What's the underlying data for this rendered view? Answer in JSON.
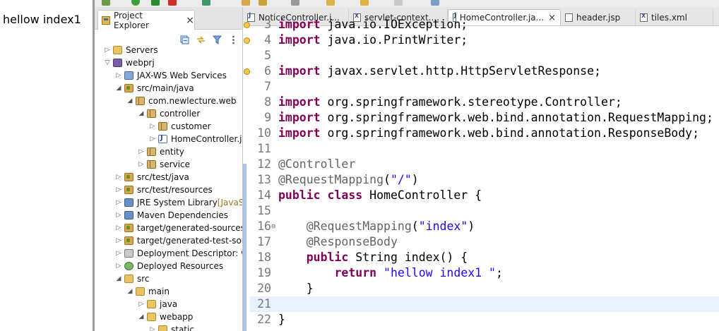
{
  "browser": {
    "output_text": "hellow index1"
  },
  "explorer": {
    "tab_label": "Project Explorer",
    "close_glyph": "×",
    "tree": [
      {
        "label": "Servers",
        "extra": "",
        "indent": 1,
        "twisty": "▷",
        "icon": "folder"
      },
      {
        "label": "webprj",
        "extra": "",
        "indent": 1,
        "twisty": "▽",
        "icon": "project"
      },
      {
        "label": "JAX-WS Web Services",
        "extra": "",
        "indent": 2,
        "twisty": "▷",
        "icon": "ws"
      },
      {
        "label": "src/main/java",
        "extra": "",
        "indent": 2,
        "twisty": "◢",
        "icon": "srcfolder"
      },
      {
        "label": "com.newlecture.web",
        "extra": "",
        "indent": 3,
        "twisty": "◢",
        "icon": "package"
      },
      {
        "label": "controller",
        "extra": "",
        "indent": 4,
        "twisty": "◢",
        "icon": "package"
      },
      {
        "label": "customer",
        "extra": "",
        "indent": 5,
        "twisty": "▷",
        "icon": "package"
      },
      {
        "label": "HomeController.ja",
        "extra": "",
        "indent": 5,
        "twisty": "▷",
        "icon": "java"
      },
      {
        "label": "entity",
        "extra": "",
        "indent": 4,
        "twisty": "▷",
        "icon": "package"
      },
      {
        "label": "service",
        "extra": "",
        "indent": 4,
        "twisty": "▷",
        "icon": "package"
      },
      {
        "label": "src/test/java",
        "extra": "",
        "indent": 2,
        "twisty": "▷",
        "icon": "srcfolder"
      },
      {
        "label": "src/test/resources",
        "extra": "",
        "indent": 2,
        "twisty": "▷",
        "icon": "srcfolder"
      },
      {
        "label": "JRE System Library",
        "extra": " [JavaSE-",
        "indent": 2,
        "twisty": "▷",
        "icon": "lib"
      },
      {
        "label": "Maven Dependencies",
        "extra": "",
        "indent": 2,
        "twisty": "▷",
        "icon": "lib"
      },
      {
        "label": "target/generated-sources/a",
        "extra": "",
        "indent": 2,
        "twisty": "▷",
        "icon": "srcfolder"
      },
      {
        "label": "target/generated-test-sourc",
        "extra": "",
        "indent": 2,
        "twisty": "▷",
        "icon": "srcfolder"
      },
      {
        "label": "Deployment Descriptor: we",
        "extra": "",
        "indent": 2,
        "twisty": "▷",
        "icon": "dd"
      },
      {
        "label": "Deployed Resources",
        "extra": "",
        "indent": 2,
        "twisty": "▷",
        "icon": "globe"
      },
      {
        "label": "src",
        "extra": "",
        "indent": 2,
        "twisty": "◢",
        "icon": "folder"
      },
      {
        "label": "main",
        "extra": "",
        "indent": 3,
        "twisty": "◢",
        "icon": "folder"
      },
      {
        "label": "java",
        "extra": "",
        "indent": 4,
        "twisty": "▷",
        "icon": "folder"
      },
      {
        "label": "webapp",
        "extra": "",
        "indent": 4,
        "twisty": "◢",
        "icon": "folder"
      },
      {
        "label": "static",
        "extra": "",
        "indent": 5,
        "twisty": "▷",
        "icon": "folder"
      }
    ]
  },
  "editor": {
    "tabs": [
      {
        "label": "NoticeController.j...",
        "kind": "j",
        "active": false
      },
      {
        "label": "servlet-context....",
        "kind": "x",
        "active": false
      },
      {
        "label": "HomeController.ja...",
        "kind": "j",
        "active": true
      },
      {
        "label": "header.jsp",
        "kind": "p",
        "active": false
      },
      {
        "label": "tiles.xml",
        "kind": "x",
        "active": false
      }
    ],
    "lines": [
      {
        "n": "3",
        "warn": true,
        "fold": "",
        "segs": [
          [
            "kw",
            "import"
          ],
          [
            "",
            " java.io.IOException;"
          ]
        ]
      },
      {
        "n": "4",
        "warn": true,
        "fold": "",
        "segs": [
          [
            "kw",
            "import"
          ],
          [
            "",
            " java.io.PrintWriter;"
          ]
        ]
      },
      {
        "n": "5",
        "warn": false,
        "fold": "",
        "segs": []
      },
      {
        "n": "6",
        "warn": true,
        "fold": "",
        "segs": [
          [
            "kw",
            "import"
          ],
          [
            "",
            " javax.servlet.http.HttpServletResponse;"
          ]
        ]
      },
      {
        "n": "7",
        "warn": false,
        "fold": "",
        "segs": []
      },
      {
        "n": "8",
        "warn": false,
        "fold": "",
        "segs": [
          [
            "kw",
            "import"
          ],
          [
            "",
            " org.springframework.stereotype.Controller;"
          ]
        ]
      },
      {
        "n": "9",
        "warn": false,
        "fold": "",
        "segs": [
          [
            "kw",
            "import"
          ],
          [
            "",
            " org.springframework.web.bind.annotation.RequestMapping;"
          ]
        ]
      },
      {
        "n": "10",
        "warn": false,
        "fold": "",
        "segs": [
          [
            "kw",
            "import"
          ],
          [
            "",
            " org.springframework.web.bind.annotation.ResponseBody;"
          ]
        ]
      },
      {
        "n": "11",
        "warn": false,
        "fold": "",
        "segs": []
      },
      {
        "n": "12",
        "warn": false,
        "fold": "",
        "segs": [
          [
            "ann",
            "@Controller"
          ]
        ]
      },
      {
        "n": "13",
        "warn": false,
        "fold": "",
        "segs": [
          [
            "ann",
            "@RequestMapping"
          ],
          [
            "",
            "("
          ],
          [
            "str",
            "\"/\""
          ],
          [
            "",
            ")"
          ]
        ]
      },
      {
        "n": "14",
        "warn": false,
        "fold": "",
        "segs": [
          [
            "kw",
            "public class"
          ],
          [
            "",
            " HomeController {"
          ]
        ]
      },
      {
        "n": "15",
        "warn": false,
        "fold": "",
        "segs": []
      },
      {
        "n": "16",
        "warn": false,
        "fold": "⊖",
        "segs": [
          [
            "",
            "    "
          ],
          [
            "ann",
            "@RequestMapping"
          ],
          [
            "",
            "("
          ],
          [
            "str",
            "\"index\""
          ],
          [
            "",
            ")"
          ]
        ]
      },
      {
        "n": "17",
        "warn": false,
        "fold": "",
        "segs": [
          [
            "",
            "    "
          ],
          [
            "ann",
            "@ResponseBody"
          ]
        ]
      },
      {
        "n": "18",
        "warn": false,
        "fold": "",
        "segs": [
          [
            "",
            "    "
          ],
          [
            "kw",
            "public"
          ],
          [
            "",
            " String index() {"
          ]
        ]
      },
      {
        "n": "19",
        "warn": false,
        "fold": "",
        "segs": [
          [
            "",
            "        "
          ],
          [
            "kw",
            "return"
          ],
          [
            "",
            " "
          ],
          [
            "str",
            "\"hellow index1 \""
          ],
          [
            "",
            ";"
          ]
        ]
      },
      {
        "n": "20",
        "warn": false,
        "fold": "",
        "segs": [
          [
            "",
            "    }"
          ]
        ]
      },
      {
        "n": "21",
        "warn": false,
        "fold": "",
        "segs": [],
        "current": true
      },
      {
        "n": "22",
        "warn": false,
        "fold": "",
        "segs": [
          [
            "",
            "}"
          ]
        ]
      }
    ]
  }
}
